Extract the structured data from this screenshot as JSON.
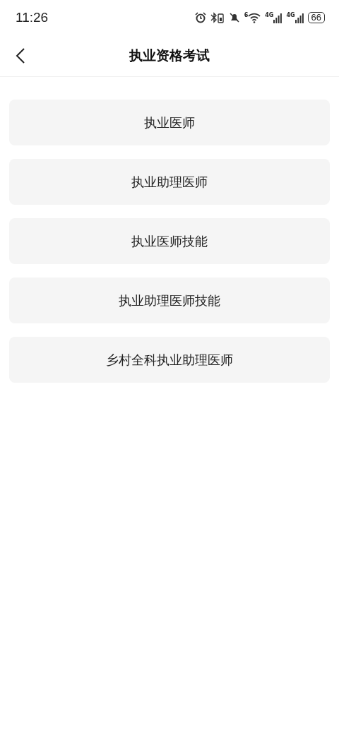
{
  "status_bar": {
    "time": "11:26",
    "wifi_label": "6",
    "sim_labels": [
      "4G",
      "4G"
    ],
    "battery": "66"
  },
  "header": {
    "title": "执业资格考试"
  },
  "options": [
    {
      "label": "执业医师"
    },
    {
      "label": "执业助理医师"
    },
    {
      "label": "执业医师技能"
    },
    {
      "label": "执业助理医师技能"
    },
    {
      "label": "乡村全科执业助理医师"
    }
  ]
}
